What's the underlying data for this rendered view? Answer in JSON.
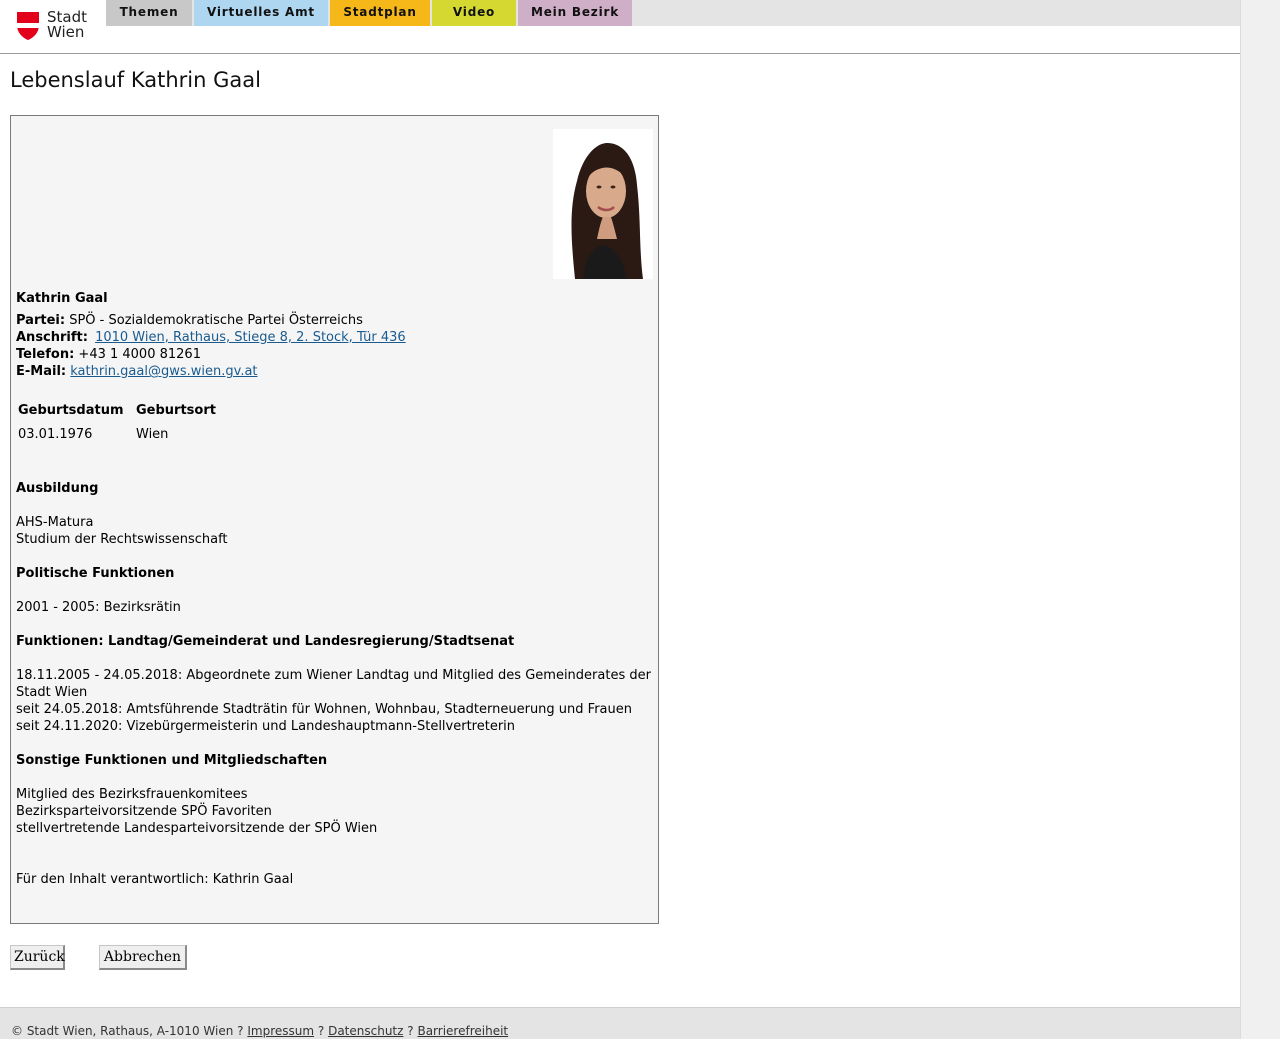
{
  "header": {
    "logo_line1": "Stadt",
    "logo_line2": "Wien",
    "tabs": [
      {
        "label": "Themen",
        "color": "#c8c8c8"
      },
      {
        "label": "Virtuelles Amt",
        "color": "#aed6f1"
      },
      {
        "label": "Stadtplan",
        "color": "#f6b818"
      },
      {
        "label": "Video",
        "color": "#d6d832"
      },
      {
        "label": "Mein Bezirk",
        "color": "#cfafc8"
      }
    ]
  },
  "page_title": "Lebenslauf Kathrin Gaal",
  "profile": {
    "name": "Kathrin Gaal",
    "party_label": "Partei:",
    "party": "SPÖ - Sozialdemokratische Partei Österreichs",
    "address_label": "Anschrift:",
    "address": "1010 Wien, Rathaus, Stiege 8, 2. Stock, Tür 436",
    "phone_label": "Telefon:",
    "phone": "+43 1 4000 81261",
    "email_label": "E-Mail:",
    "email": "kathrin.gaal@gws.wien.gv.at"
  },
  "birth_table": {
    "headers": [
      "Geburtsdatum",
      "Geburtsort"
    ],
    "row": [
      "03.01.1976",
      "Wien"
    ]
  },
  "sections": {
    "education_title": "Ausbildung",
    "education": [
      "AHS-Matura",
      "Studium der Rechtswissenschaft"
    ],
    "political_title": "Politische Funktionen",
    "political": [
      "2001 - 2005: Bezirksrätin"
    ],
    "functions_title": "Funktionen: Landtag/Gemeinderat und Landesregierung/Stadtsenat",
    "functions": [
      "18.11.2005 - 24.05.2018: Abgeordnete zum Wiener Landtag und Mitglied des Gemeinderates der",
      "Stadt Wien",
      "seit 24.05.2018: Amtsführende Stadträtin für Wohnen, Wohnbau, Stadterneuerung und Frauen",
      "seit 24.11.2020: Vizebürgermeisterin und Landeshauptmann-Stellvertreterin"
    ],
    "other_title": "Sonstige Funktionen und Mitgliedschaften",
    "other": [
      "Mitglied des Bezirksfrauenkomitees",
      "Bezirksparteivorsitzende SPÖ Favoriten",
      "stellvertretende Landesparteivorsitzende der SPÖ Wien"
    ],
    "responsible": "Für den Inhalt verantwortlich: Kathrin Gaal"
  },
  "buttons": {
    "back": "Zurück",
    "cancel": "Abbrechen"
  },
  "footer": {
    "copyright": "© Stadt Wien, Rathaus, A-1010 Wien",
    "sep": "?",
    "links": [
      "Impressum",
      "Datenschutz",
      "Barrierefreiheit"
    ]
  },
  "colors": {
    "link": "#1a5b8f",
    "logo_red": "#e2001a",
    "box_bg": "#f5f5f5"
  }
}
